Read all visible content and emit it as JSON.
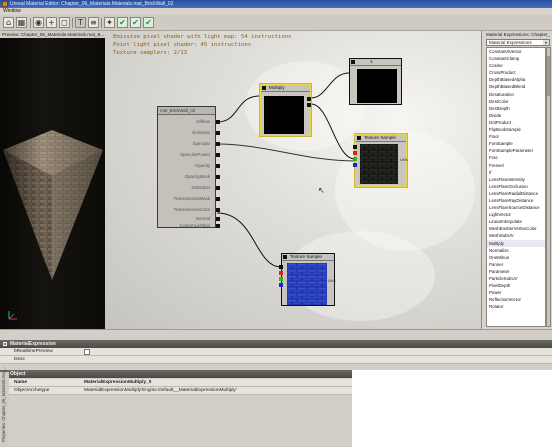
{
  "window": {
    "title": "Unreal Material Editor: Chapter_06_Materials.Materials.mat_BrickWall_02"
  },
  "menu": {
    "window_label": "Window"
  },
  "toolbar": {
    "buttons": [
      "home-icon",
      "grid-icon",
      "eye-icon",
      "plus-icon",
      "cube-icon",
      "text-icon",
      "lines-icon",
      "apply-icon",
      "check-icon",
      "check-icon",
      "check-icon"
    ]
  },
  "preview": {
    "title": "Preview: Chapter_06_Materials.Materials.mat_B..."
  },
  "graph": {
    "stats": [
      "Emissive pixel shader with light map: 54 instructions",
      "Point light pixel shader: 45 instructions",
      "Texture samplers: 2/13"
    ],
    "material_node": {
      "title": "mat_BrickWall_02",
      "inputs": [
        "Diffuse",
        "Emissive",
        "Specular",
        "SpecularPower",
        "Opacity",
        "OpacityMask",
        "Distortion",
        "TransmissionMask",
        "TransmissionColor",
        "Normal",
        "CustomLighting"
      ]
    },
    "multiply_node": {
      "title": "Multiply",
      "pins": [
        "A",
        "B"
      ]
    },
    "constant_node": {
      "title": "1"
    },
    "texture_top": {
      "title": "Texture Sample",
      "uvs_label": "UVs"
    },
    "texture_bottom": {
      "title": "Texture Sample",
      "uvs_label": "UVs"
    }
  },
  "expressions": {
    "panel_title": "Material Expressions: Chapter_",
    "combo": "Material Expressions",
    "items": [
      "ConstantClamp",
      "Cosine",
      "CrossProduct",
      "DepthBiasedAlpha",
      "DepthBiasedBlend",
      "Desaturation",
      "DestColor",
      "DestDepth",
      "Divide",
      "DotProduct",
      "FlipBookSample",
      "Floor",
      "FontSample",
      "FontSampleParameter",
      "Frac",
      "Fresnel",
      "If",
      "LensFlareIntensity",
      "LensFlareOcclusion",
      "LensFlareRadialDistance",
      "LensFlareRayDistance",
      "LensFlareSourceDistance",
      "LightVector",
      "LinearInterpolate",
      "MeshEmitterVertexColor",
      "MeshSubUV",
      "Multiply",
      "Normalize",
      "OneMinus",
      "Panner",
      "Parameter",
      "ParticleSubUV",
      "PixelDepth",
      "Power",
      "ReflectionVector",
      "Rotator"
    ],
    "selected": "Multiply",
    "top_item": "Constant4Vector"
  },
  "properties": {
    "group1": "MaterialExpression",
    "row1_key": "bRealtimePreview",
    "row2_key": "Desc",
    "group2": "Object",
    "name_key": "Name",
    "name_value": "MaterialExpressionMultiply_0",
    "archetype_key": "ObjectArchetype",
    "archetype_value": "MaterialExpressionMultiply'Engine.Default__MaterialExpressionMultiply'"
  },
  "side_tab": {
    "label": "Properties: Chapter_06_Materials.mat_..."
  },
  "colors": {
    "selection": "#e8d84a",
    "stats_text": "#8e6010",
    "brick": "#2d3fb8"
  }
}
